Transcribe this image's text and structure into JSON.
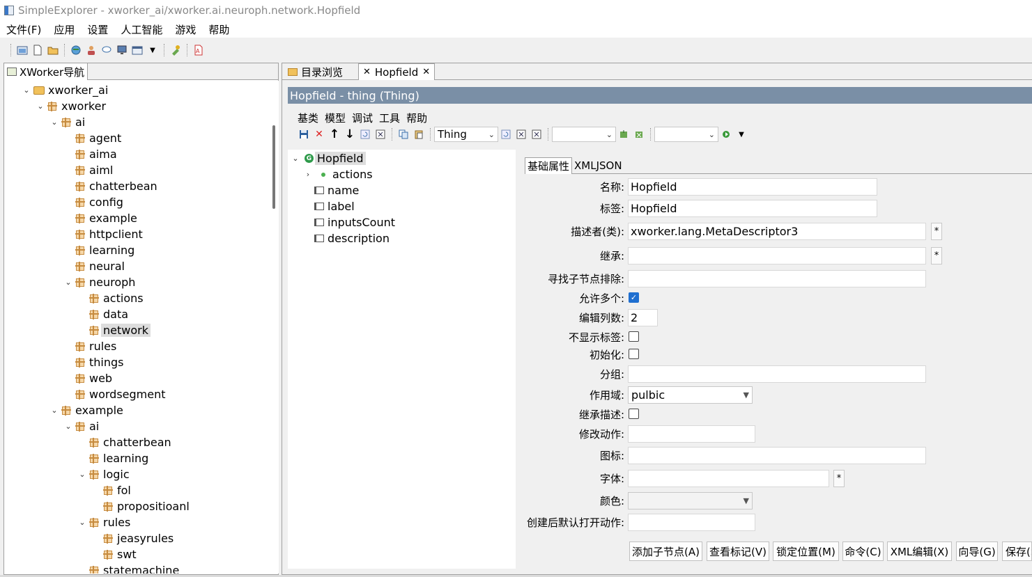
{
  "window": {
    "title": "SimpleExplorer - xworker_ai/xworker.ai.neuroph.network.Hopfield"
  },
  "menubar": [
    "文件(F)",
    "应用",
    "设置",
    "人工智能",
    "游戏",
    "帮助"
  ],
  "toolbar_icons": [
    "home-icon",
    "new-file-icon",
    "open-folder-icon",
    "refresh-world-icon",
    "user-icon",
    "chat-icon",
    "monitor-icon",
    "window-icon",
    "dropdown-arrow-icon",
    "tools-icon",
    "pdf-icon"
  ],
  "left_panel": {
    "tab": "XWorker导航",
    "tree": [
      {
        "label": "xworker_ai",
        "level": 0,
        "expanded": true,
        "icon": "folder"
      },
      {
        "label": "xworker",
        "level": 1,
        "expanded": true
      },
      {
        "label": "ai",
        "level": 2,
        "expanded": true
      },
      {
        "label": "agent",
        "level": 3
      },
      {
        "label": "aima",
        "level": 3
      },
      {
        "label": "aiml",
        "level": 3
      },
      {
        "label": "chatterbean",
        "level": 3
      },
      {
        "label": "config",
        "level": 3
      },
      {
        "label": "example",
        "level": 3
      },
      {
        "label": "httpclient",
        "level": 3
      },
      {
        "label": "learning",
        "level": 3
      },
      {
        "label": "neural",
        "level": 3
      },
      {
        "label": "neuroph",
        "level": 3,
        "expanded": true
      },
      {
        "label": "actions",
        "level": 4
      },
      {
        "label": "data",
        "level": 4
      },
      {
        "label": "network",
        "level": 4,
        "selected": true
      },
      {
        "label": "rules",
        "level": 3
      },
      {
        "label": "things",
        "level": 3
      },
      {
        "label": "web",
        "level": 3
      },
      {
        "label": "wordsegment",
        "level": 3
      },
      {
        "label": "example",
        "level": 2,
        "expanded": true
      },
      {
        "label": "ai",
        "level": 3,
        "expanded": true
      },
      {
        "label": "chatterbean",
        "level": 4
      },
      {
        "label": "learning",
        "level": 4
      },
      {
        "label": "logic",
        "level": 4,
        "expanded": true
      },
      {
        "label": "fol",
        "level": 5
      },
      {
        "label": "propositioanl",
        "level": 5
      },
      {
        "label": "rules",
        "level": 4,
        "expanded": true
      },
      {
        "label": "jeasyrules",
        "level": 5
      },
      {
        "label": "swt",
        "level": 5
      },
      {
        "label": "statemachine",
        "level": 4
      }
    ]
  },
  "right_panel": {
    "tabs": [
      {
        "label": "目录浏览",
        "active": false
      },
      {
        "label": "Hopfield",
        "active": true
      }
    ],
    "editor_title": "Hopfield - thing  (Thing)",
    "editor_menu": [
      "基类",
      "模型",
      "调试",
      "工具",
      "帮助"
    ],
    "type_combo": "Thing",
    "node_tree": [
      {
        "label": "Hopfield",
        "kind": "root",
        "selected": true
      },
      {
        "label": "actions",
        "kind": "actions"
      },
      {
        "label": "name",
        "kind": "attr"
      },
      {
        "label": "label",
        "kind": "attr"
      },
      {
        "label": "inputsCount",
        "kind": "attr"
      },
      {
        "label": "description",
        "kind": "attr"
      }
    ],
    "prop_tabs": [
      "基础属性",
      "XMLJSON"
    ],
    "form": {
      "name_label": "名称:",
      "name_value": "Hopfield",
      "label_label": "标签:",
      "label_value": "Hopfield",
      "descriptor_label": "描述者(类):",
      "descriptor_value": "xworker.lang.MetaDescriptor3",
      "extends_label": "继承:",
      "extends_value": "",
      "exclude_label": "寻找子节点排除:",
      "exclude_value": "",
      "many_label": "允许多个:",
      "many_checked": true,
      "cols_label": "编辑列数:",
      "cols_value": "2",
      "nolabel_label": "不显示标签:",
      "nolabel_checked": false,
      "init_label": "初始化:",
      "init_checked": false,
      "group_label": "分组:",
      "group_value": "",
      "scope_label": "作用域:",
      "scope_value": "pulbic",
      "inheritdesc_label": "继承描述:",
      "inheritdesc_checked": false,
      "modify_label": "修改动作:",
      "modify_value": "",
      "icon_label": "图标:",
      "icon_value": "",
      "font_label": "字体:",
      "font_value": "",
      "color_label": "颜色:",
      "color_value": "",
      "openaction_label": "创建后默认打开动作:",
      "openaction_value": "",
      "star": "*"
    },
    "buttons": [
      "添加子节点(A)",
      "查看标记(V)",
      "锁定位置(M)",
      "命令(C)",
      "XML编辑(X)",
      "向导(G)",
      "保存(S)"
    ]
  },
  "colors": {
    "title_bar": "#7a8fa6",
    "check_on": "#1f6fd0",
    "package_icon": "#c68b3f"
  }
}
